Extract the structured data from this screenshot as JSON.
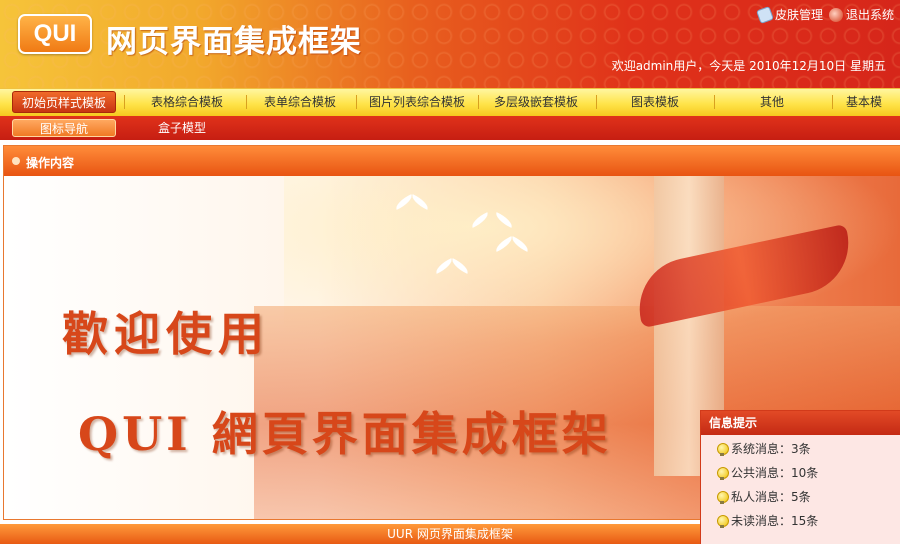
{
  "header": {
    "logo": "QUI",
    "title": "网页界面集成框架",
    "links": [
      {
        "label": "皮肤管理",
        "icon": "skin-icon"
      },
      {
        "label": "退出系统",
        "icon": "exit-icon"
      }
    ],
    "welcome": "欢迎admin用户，今天是 2010年12月10日 星期五"
  },
  "nav": {
    "items": [
      {
        "label": "初始页样式模板",
        "active": true
      },
      {
        "label": "表格综合模板"
      },
      {
        "label": "表单综合模板"
      },
      {
        "label": "图片列表综合模板"
      },
      {
        "label": "多层级嵌套模板"
      },
      {
        "label": "图表模板"
      },
      {
        "label": "其他"
      },
      {
        "label": "基本模"
      }
    ]
  },
  "subnav": {
    "items": [
      {
        "label": "图标导航",
        "active": true
      },
      {
        "label": "盒子模型"
      }
    ]
  },
  "panel": {
    "title": "操作内容",
    "banner_line1": "歡迎使用",
    "banner_line2": "QUI 網頁界面集成框架"
  },
  "info": {
    "title": "信息提示",
    "rows": [
      {
        "label": "系统消息：3条"
      },
      {
        "label": "公共消息：10条"
      },
      {
        "label": "私人消息：5条"
      },
      {
        "label": "未读消息：15条"
      }
    ]
  },
  "footer": {
    "text": "UUR 网页界面集成框架"
  },
  "colors": {
    "brand_red": "#d6261a",
    "brand_orange": "#e85412",
    "nav_yellow": "#ffe44a"
  }
}
